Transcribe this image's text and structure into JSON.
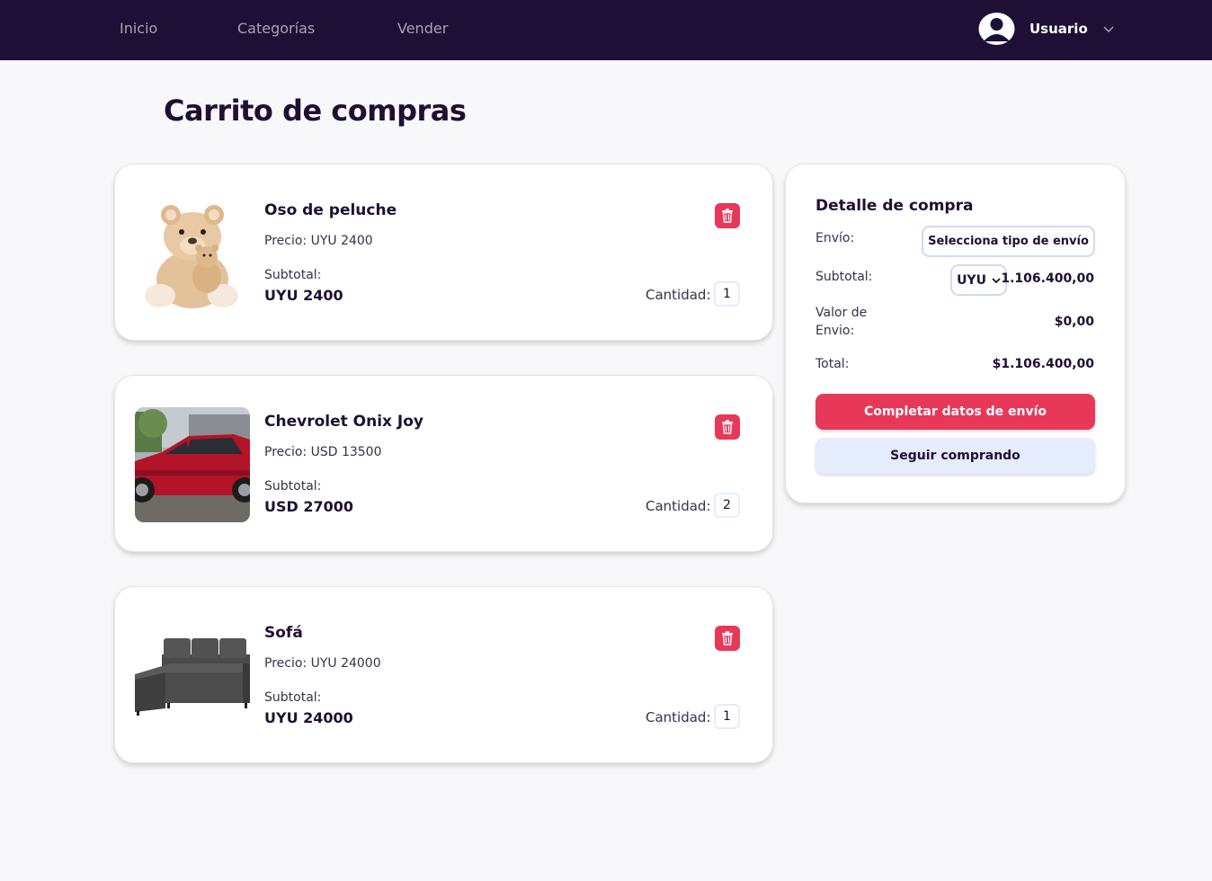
{
  "nav": {
    "links": [
      "Inicio",
      "Categorías",
      "Vender"
    ],
    "user_name": "Usuario",
    "user_icon": "user-avatar-icon",
    "dropdown_icon": "chevron-down-icon"
  },
  "page_title": "Carrito de compras",
  "cart_items": [
    {
      "name": "Oso de peluche",
      "price": "Precio: UYU 2400",
      "subtotal_label": "Subtotal:",
      "subtotal": "UYU 2400",
      "quantity_label": "Cantidad:",
      "quantity": "1",
      "image": "teddy-bear-image"
    },
    {
      "name": "Chevrolet Onix Joy",
      "price": "Precio: USD 13500",
      "subtotal_label": "Subtotal:",
      "subtotal": "USD 27000",
      "quantity_label": "Cantidad:",
      "quantity": "2",
      "image": "red-car-image"
    },
    {
      "name": "Sofá",
      "price": "Precio: UYU 24000",
      "subtotal_label": "Subtotal:",
      "subtotal": "UYU 24000",
      "quantity_label": "Cantidad:",
      "quantity": "1",
      "image": "gray-sofa-image"
    }
  ],
  "summary": {
    "title": "Detalle de compra",
    "shipping_label": "Envío:",
    "shipping_select": "Selecciona tipo de envío",
    "subtotal_label": "Subtotal:",
    "currency": "UYU",
    "subtotal_value": "1.106.400,00",
    "shipping_cost_label_1": "Valor de",
    "shipping_cost_label_2": "Envio:",
    "shipping_cost_value": "$0,00",
    "total_label": "Total:",
    "total_value": "$1.106.400,00",
    "primary_button": "Completar datos de envío",
    "secondary_button": "Seguir comprando"
  },
  "colors": {
    "navbar": "#1e0f36",
    "accent": "#e8385a",
    "secondary_button": "#e5ecfb",
    "text_dark": "#1e1033"
  }
}
